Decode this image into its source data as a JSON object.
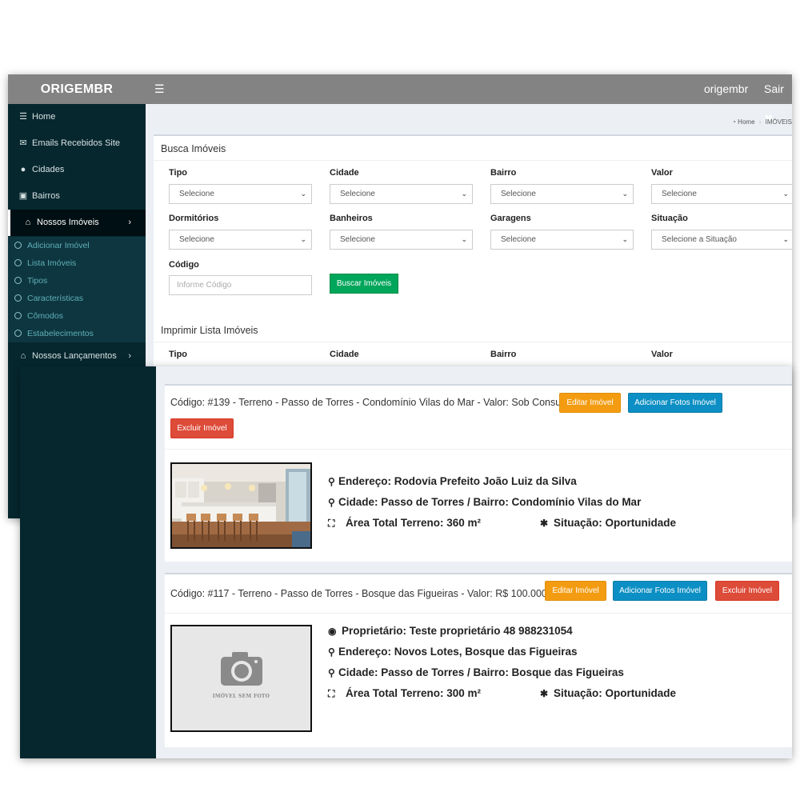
{
  "app": {
    "logo": "ORIGEMBR",
    "menu_icon": "☰",
    "user": "origembr",
    "logout": "Sair ✖"
  },
  "sidebar": {
    "items": [
      {
        "label": "Home",
        "icon": "bars-icon"
      },
      {
        "label": "Emails Recebidos Site",
        "icon": "envelope-icon"
      },
      {
        "label": "Cidades",
        "icon": "map-marker-icon"
      },
      {
        "label": "Bairros",
        "icon": "map-icon"
      },
      {
        "label": "Nossos Imóveis",
        "icon": "home-icon"
      }
    ],
    "subitems": [
      "Adicionar Imóvel",
      "Lista Imóveis",
      "Tipos",
      "Características",
      "Cômodos",
      "Estabelecimentos"
    ],
    "extra": {
      "label": "Nossos Lançamentos",
      "icon": "home-icon"
    }
  },
  "breadcrumb": {
    "home": "Home",
    "current": "IMÓVEIS"
  },
  "search": {
    "title": "Busca Imóveis",
    "fields": [
      {
        "label": "Tipo",
        "value": "Selecione"
      },
      {
        "label": "Cidade",
        "value": "Selecione"
      },
      {
        "label": "Bairro",
        "value": "Selecione"
      },
      {
        "label": "Valor",
        "value": "Selecione"
      },
      {
        "label": "Dormitórios",
        "value": "Selecione"
      },
      {
        "label": "Banheiros",
        "value": "Selecione"
      },
      {
        "label": "Garagens",
        "value": "Selecione"
      },
      {
        "label": "Situação",
        "value": "Selecione a Situação"
      }
    ],
    "code_label": "Código",
    "code_placeholder": "Informe Código",
    "button": "Buscar Imóveis"
  },
  "print": {
    "title": "Imprimir Lista Imóveis",
    "fields": [
      "Tipo",
      "Cidade",
      "Bairro",
      "Valor"
    ]
  },
  "listings": [
    {
      "title": "Código: #139 - Terreno - Passo de Torres - Condomínio Vilas do Mar - Valor: Sob Consulta",
      "edit": "Editar Imóvel",
      "photos": "Adicionar Fotos Imóvel",
      "delete": "Excluir Imóvel",
      "address": "Endereço: Rodovia Prefeito João Luiz da Silva",
      "city": "Cidade: Passo de Torres / Bairro: Condomínio Vilas do Mar",
      "area": "Área Total Terreno: 360 m²",
      "status": "Situação: Oportunidade"
    },
    {
      "title": "Código: #117 - Terreno - Passo de Torres - Bosque das Figueiras - Valor: R$ 100.000,00",
      "edit": "Editar Imóvel",
      "photos": "Adicionar Fotos Imóvel",
      "delete": "Excluir Imóvel",
      "owner": "Proprietário: Teste proprietário 48 988231054",
      "address": "Endereço: Novos Lotes, Bosque das Figueiras",
      "city": "Cidade: Passo de Torres / Bairro: Bosque das Figueiras",
      "area": "Área Total Terreno: 300 m²",
      "status": "Situação: Oportunidade",
      "no_photo": "IMÓVEL SEM FOTO"
    }
  ],
  "colors": {
    "topbar": "#838383",
    "sidebar": "#06272e",
    "success": "#00a65a",
    "warning": "#f39c12",
    "info": "#0c8fc4",
    "danger": "#dd4b39"
  }
}
